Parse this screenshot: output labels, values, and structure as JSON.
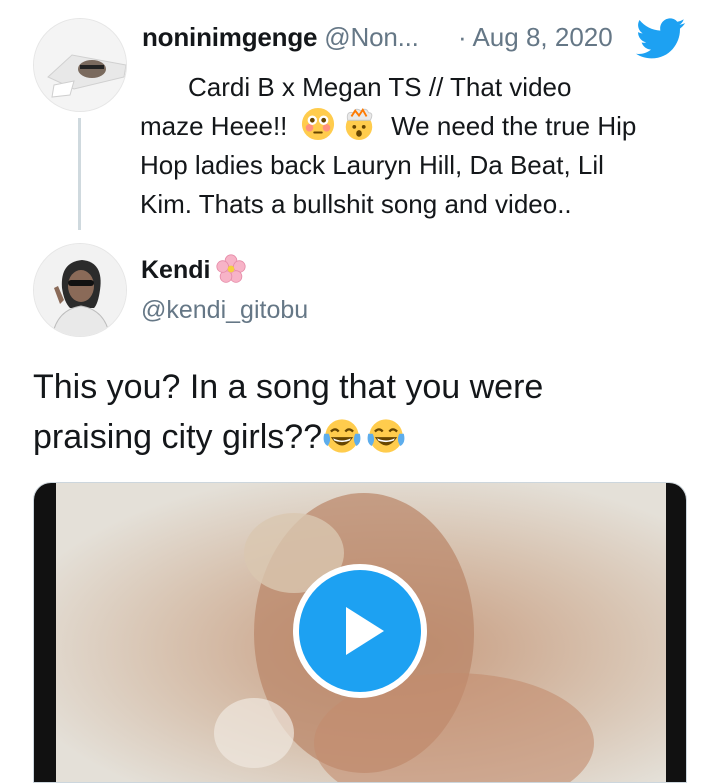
{
  "quoted_tweet": {
    "display_name": "noninimgenge",
    "handle": "@Non...",
    "separator": "·",
    "date": "Aug 8, 2020",
    "text_lines": [
      "Cardi B x Megan TS // That video",
      "maze Heee!!",
      "We need the true Hip",
      "Hop ladies back Lauryn Hill, Da Beat, Lil",
      "Kim. Thats a bullshit song and video.."
    ],
    "icons": [
      "avatar",
      "twitter-bird-icon",
      "flushed-face-emoji-icon",
      "exploding-head-emoji-icon"
    ]
  },
  "tweet": {
    "display_name": "Kendi",
    "handle": "@kendi_gitobu",
    "text_lines": [
      "This you? In a song that you were",
      "praising city girls??"
    ],
    "icons": [
      "cherry-blossom-icon",
      "tears-of-joy-emoji-icon"
    ],
    "media": {
      "type": "video",
      "control": "play-button-icon"
    }
  },
  "colors": {
    "text": "#14171a",
    "secondary": "#657786",
    "twitter_blue": "#1da1f2",
    "thread_line": "#cfd9de"
  }
}
